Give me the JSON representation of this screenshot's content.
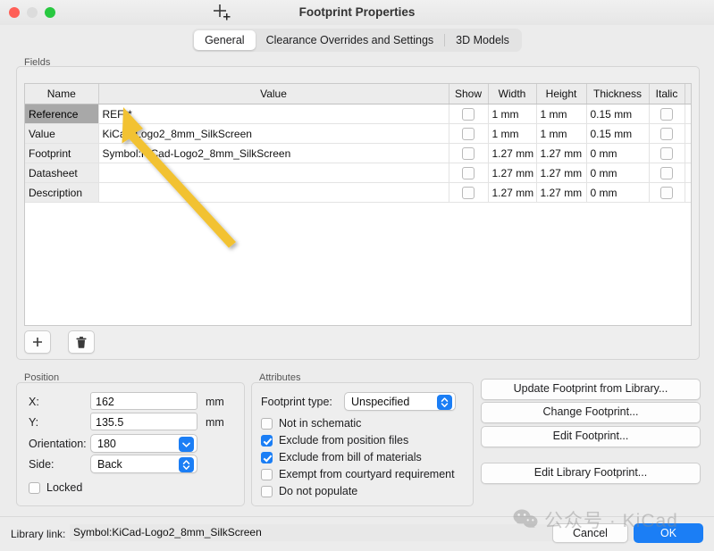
{
  "window": {
    "title": "Footprint Properties",
    "traffic_lights": [
      "close",
      "minimize",
      "zoom"
    ]
  },
  "tabs": [
    {
      "label": "General",
      "active": true
    },
    {
      "label": "Clearance Overrides and Settings",
      "active": false
    },
    {
      "label": "3D Models",
      "active": false
    }
  ],
  "fields": {
    "group_label": "Fields",
    "columns": [
      "Name",
      "Value",
      "Show",
      "Width",
      "Height",
      "Thickness",
      "Italic"
    ],
    "rows": [
      {
        "name": "Reference",
        "value": "REF**",
        "show": false,
        "width": "1 mm",
        "height": "1 mm",
        "thickness": "0.15 mm",
        "italic": false,
        "selected": true
      },
      {
        "name": "Value",
        "value": "KiCad-Logo2_8mm_SilkScreen",
        "show": false,
        "width": "1 mm",
        "height": "1 mm",
        "thickness": "0.15 mm",
        "italic": false,
        "selected": false
      },
      {
        "name": "Footprint",
        "value": "Symbol:KiCad-Logo2_8mm_SilkScreen",
        "show": false,
        "width": "1.27 mm",
        "height": "1.27 mm",
        "thickness": "0 mm",
        "italic": false,
        "selected": false
      },
      {
        "name": "Datasheet",
        "value": "",
        "show": false,
        "width": "1.27 mm",
        "height": "1.27 mm",
        "thickness": "0 mm",
        "italic": false,
        "selected": false
      },
      {
        "name": "Description",
        "value": "",
        "show": false,
        "width": "1.27 mm",
        "height": "1.27 mm",
        "thickness": "0 mm",
        "italic": false,
        "selected": false
      }
    ],
    "add_icon": "plus-icon",
    "delete_icon": "trash-icon"
  },
  "position": {
    "group_label": "Position",
    "x_label": "X:",
    "x_value": "162",
    "x_unit": "mm",
    "y_label": "Y:",
    "y_value": "135.5",
    "y_unit": "mm",
    "orientation_label": "Orientation:",
    "orientation_value": "180",
    "side_label": "Side:",
    "side_value": "Back",
    "locked_label": "Locked",
    "locked_checked": false
  },
  "attributes": {
    "group_label": "Attributes",
    "type_label": "Footprint type:",
    "type_value": "Unspecified",
    "checks": [
      {
        "label": "Not in schematic",
        "checked": false
      },
      {
        "label": "Exclude from position files",
        "checked": true
      },
      {
        "label": "Exclude from bill of materials",
        "checked": true
      },
      {
        "label": "Exempt from courtyard requirement",
        "checked": false
      },
      {
        "label": "Do not populate",
        "checked": false
      }
    ]
  },
  "actions": [
    {
      "label": "Update Footprint from Library..."
    },
    {
      "label": "Change Footprint..."
    },
    {
      "label": "Edit Footprint..."
    },
    {
      "label": "Edit Library Footprint..."
    }
  ],
  "footer": {
    "library_link_label": "Library link:",
    "library_link_value": "Symbol:KiCad-Logo2_8mm_SilkScreen",
    "cancel_label": "Cancel",
    "ok_label": "OK"
  },
  "watermark": {
    "text": "公众号 · KiCad",
    "icon": "wechat-icon"
  },
  "colors": {
    "accent": "#1b7ef5",
    "annotation_arrow": "#f2c230",
    "window_bg": "#ececec",
    "selected_row": "#a8a8a8"
  }
}
